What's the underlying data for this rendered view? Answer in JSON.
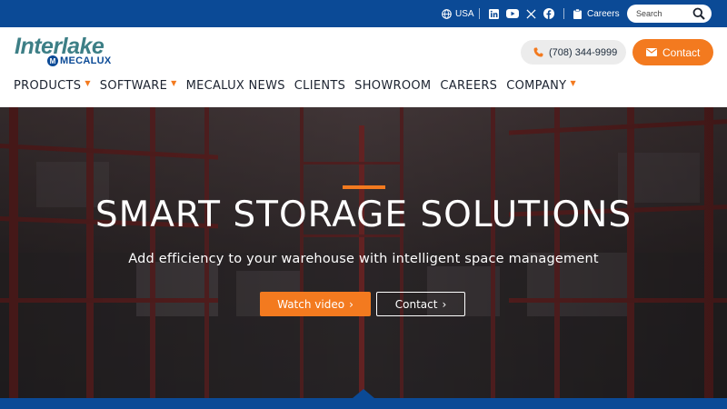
{
  "topbar": {
    "country": "USA",
    "careers": "Careers",
    "search_placeholder": "Search",
    "social": [
      "linkedin-icon",
      "youtube-icon",
      "x-icon",
      "facebook-icon"
    ]
  },
  "brand": {
    "logo_word": "Interlake",
    "logo_sub": "MECALUX",
    "logo_m": "M"
  },
  "header": {
    "phone": "(708) 344-9999",
    "contact": "Contact"
  },
  "nav": {
    "items": [
      {
        "label": "PRODUCTS"
      },
      {
        "label": "SOFTWARE"
      },
      {
        "label": "MECALUX NEWS"
      },
      {
        "label": "CLIENTS"
      },
      {
        "label": "SHOWROOM"
      },
      {
        "label": "CAREERS"
      },
      {
        "label": "COMPANY"
      }
    ]
  },
  "hero": {
    "title": "SMART STORAGE SOLUTIONS",
    "subtitle": "Add efficiency to your warehouse with intelligent space management",
    "watch_video": "Watch video",
    "contact": "Contact"
  },
  "colors": {
    "brand_blue": "#0b4a96",
    "accent_orange": "#f37a1f",
    "logo_teal": "#3d7f86"
  }
}
